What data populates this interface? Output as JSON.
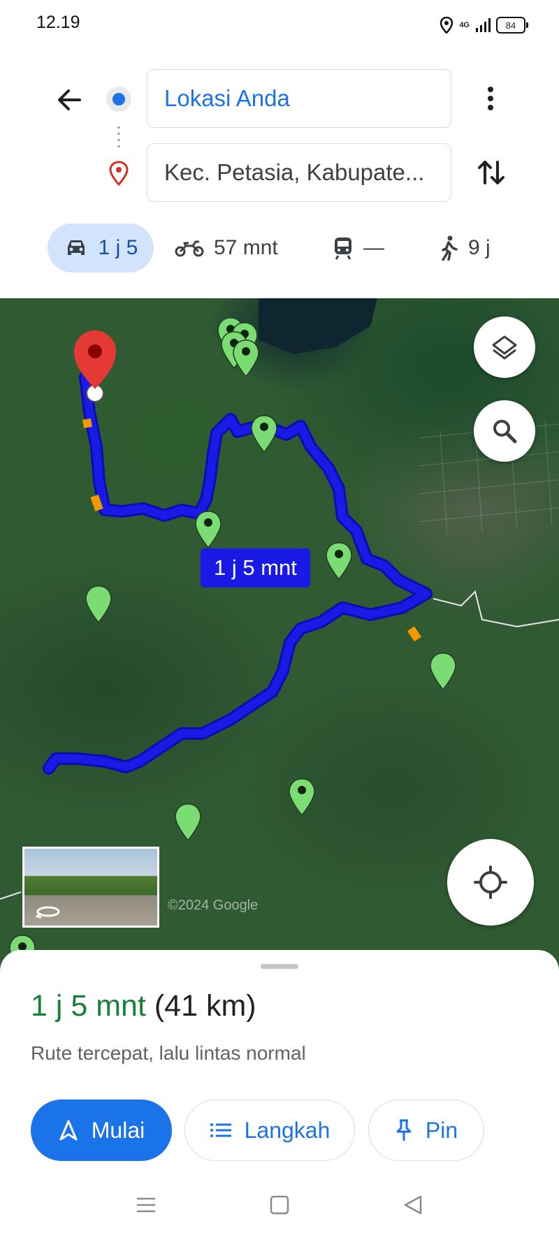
{
  "status_bar": {
    "time": "12.19",
    "network": "4G",
    "battery": "84"
  },
  "directions": {
    "origin": "Lokasi Anda",
    "destination": "Kec. Petasia, Kabupate...",
    "modes": [
      {
        "name": "car",
        "value": "1 j 5"
      },
      {
        "name": "motorcycle",
        "value": "57 mnt"
      },
      {
        "name": "transit",
        "value": "—"
      },
      {
        "name": "walk",
        "value": "9 j"
      }
    ]
  },
  "map": {
    "route_label": "1 j 5 mnt",
    "copyright": "©2024 Google",
    "route_color": "#1a1ae6"
  },
  "summary": {
    "duration": "1 j 5 mnt",
    "distance": "(41 km)",
    "description": "Rute tercepat, lalu lintas normal"
  },
  "actions": {
    "start": "Mulai",
    "steps": "Langkah",
    "pin": "Pin"
  },
  "colors": {
    "accent": "#1a73e8",
    "duration_green": "#188038",
    "selected_tab_bg": "#d2e3fc"
  }
}
